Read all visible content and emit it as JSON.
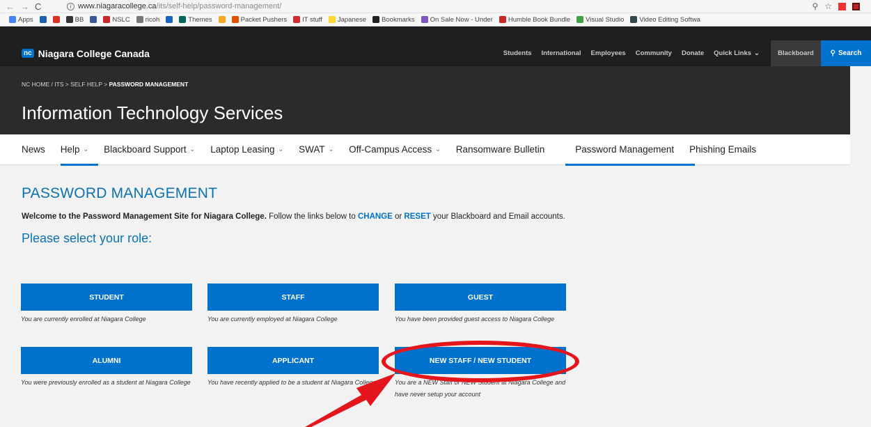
{
  "browser": {
    "nav_back": "←",
    "nav_forward": "→",
    "nav_reload": "C",
    "url_host": "www.niagaracollege.ca",
    "url_path": "/its/self-help/password-management/",
    "zoom_icon": "search-icon",
    "star_icon": "star-icon"
  },
  "bookmarks": [
    {
      "label": "Apps",
      "color": "#4285f4"
    },
    {
      "label": "",
      "color": "#1a5fb4"
    },
    {
      "label": "",
      "color": "#d93025"
    },
    {
      "label": "BB",
      "color": "#333333"
    },
    {
      "label": "",
      "color": "#3b5998"
    },
    {
      "label": "NSLC",
      "color": "#c62828"
    },
    {
      "label": "ricoh",
      "color": "#777777"
    },
    {
      "label": "",
      "color": "#1565c0"
    },
    {
      "label": "Themes",
      "color": "#00695c"
    },
    {
      "label": "",
      "color": "#f9a825"
    },
    {
      "label": "Packet Pushers",
      "color": "#e65100"
    },
    {
      "label": "IT stuff",
      "color": "#d32f2f"
    },
    {
      "label": "Japanese",
      "color": "#fdd835"
    },
    {
      "label": "Bookmarks",
      "color": "#222222"
    },
    {
      "label": "On Sale Now - Under",
      "color": "#7e57c2"
    },
    {
      "label": "Humble Book Bundle",
      "color": "#c62828"
    },
    {
      "label": "Visual Studio",
      "color": "#43a047"
    },
    {
      "label": "Video Editing Softwa",
      "color": "#37474f"
    }
  ],
  "site": {
    "logo": "nc",
    "brand": "Niagara College Canada",
    "top_links": [
      "Students",
      "International",
      "Employees",
      "Community",
      "Donate",
      "Quick Links"
    ],
    "blackboard": "Blackboard",
    "search": "Search"
  },
  "hero": {
    "crumb_home": "NC HOME",
    "crumb_sep1": "/",
    "crumb_its": "ITS",
    "crumb_sep2": ">",
    "crumb_self": "SELF HELP",
    "crumb_sep3": ">",
    "crumb_current": "PASSWORD MANAGEMENT",
    "title": "Information Technology Services"
  },
  "subnav": {
    "news": "News",
    "help": "Help",
    "blackboard_support": "Blackboard Support",
    "laptop_leasing": "Laptop Leasing",
    "swat": "SWAT",
    "off_campus": "Off-Campus Access",
    "ransomware": "Ransomware Bulletin",
    "password": "Password Management",
    "phishing": "Phishing Emails",
    "chevron": "⌄"
  },
  "main": {
    "heading": "PASSWORD MANAGEMENT",
    "welcome_bold": "Welcome to the Password Management Site for Niagara College.",
    "welcome_text1": " Follow the links below to ",
    "change": "CHANGE",
    "or": " or ",
    "reset": "RESET",
    "welcome_text2": " your Blackboard and Email accounts.",
    "role_heading": "Please select your role:"
  },
  "roles": [
    {
      "label": "STUDENT",
      "desc": "You are currently enrolled at Niagara College"
    },
    {
      "label": "STAFF",
      "desc": "You are currently employed at Niagara College"
    },
    {
      "label": "GUEST",
      "desc": "You have been provided guest access to Niagara College"
    },
    {
      "label": "ALUMNI",
      "desc": "You were previously enrolled as a student at Niagara College"
    },
    {
      "label": "APPLICANT",
      "desc": "You have recently applied to be a student at Niagara College"
    },
    {
      "label": "NEW STAFF / NEW STUDENT",
      "desc": "You are a NEW Staff or NEW Student at Niagara College and have never setup your account"
    }
  ],
  "annotation_color": "#e5151c"
}
